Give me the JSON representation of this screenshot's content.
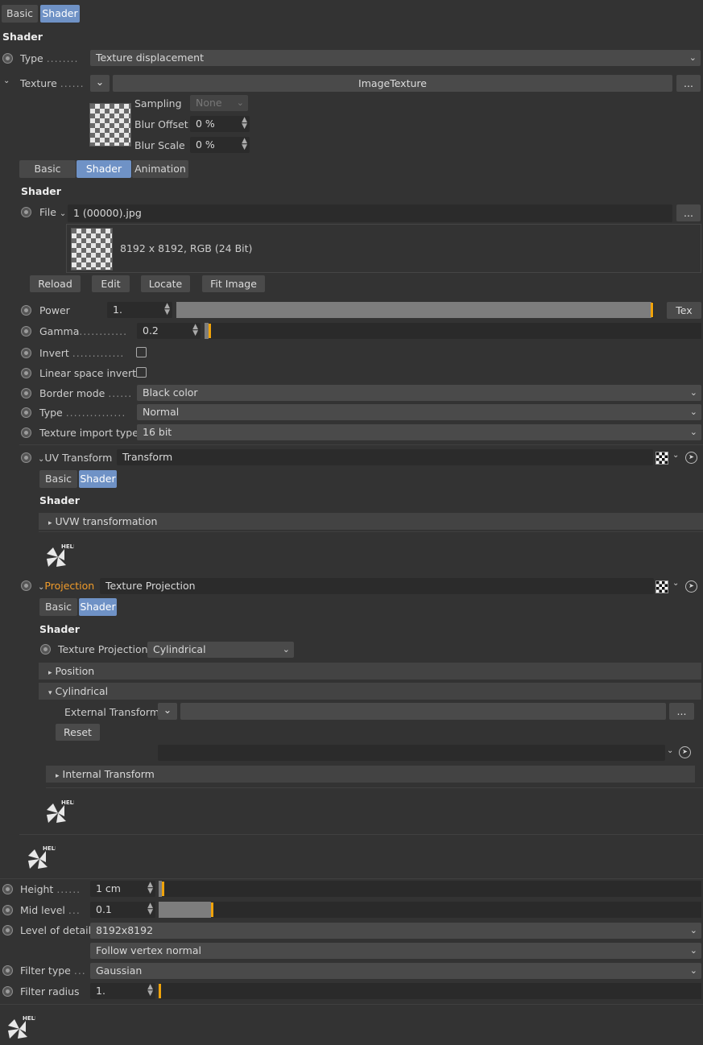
{
  "top_tabs": [
    "Basic",
    "Shader"
  ],
  "shader_header": "Shader",
  "type_row": {
    "label": "Type",
    "dots": "........",
    "value": "Texture displacement"
  },
  "texture_row": {
    "label": "Texture",
    "dots": "......",
    "name": "ImageTexture",
    "more": "..."
  },
  "sampling": {
    "label": "Sampling",
    "value": "None"
  },
  "blur_offset": {
    "label": "Blur Offset",
    "value": "0 %"
  },
  "blur_scale": {
    "label": "Blur Scale",
    "value": "0 %"
  },
  "inner_tabs": [
    "Basic",
    "Shader",
    "Animation"
  ],
  "inner_shader_header": "Shader",
  "file_row": {
    "label": "File",
    "value": "1 (00000).jpg",
    "more": "..."
  },
  "file_info": "8192 x 8192, RGB (24 Bit)",
  "file_buttons": [
    "Reload",
    "Edit",
    "Locate",
    "Fit Image"
  ],
  "power": {
    "label": "Power",
    "value": "1.",
    "button": "Tex",
    "level": 1.0
  },
  "gamma": {
    "label": "Gamma",
    "dots": "............",
    "value": "0.2",
    "level": 0.0
  },
  "invert": {
    "label": "Invert",
    "dots": ".............",
    "checked": false
  },
  "linear_invert": {
    "label": "Linear space invert",
    "checked": false
  },
  "border_mode": {
    "label": "Border mode",
    "dots": "......",
    "value": "Black color"
  },
  "type2": {
    "label": "Type",
    "dots": "...............",
    "value": "Normal"
  },
  "tex_import": {
    "label": "Texture import type",
    "value": "16 bit"
  },
  "uv_transform": {
    "label": "UV Transform",
    "value": "Transform"
  },
  "uv_tabs": [
    "Basic",
    "Shader"
  ],
  "uv_shader_header": "Shader",
  "uvw_section": "UVW transformation",
  "help_text": "HELP",
  "projection": {
    "label": "Projection",
    "value": "Texture Projection"
  },
  "proj_tabs": [
    "Basic",
    "Shader"
  ],
  "proj_shader_header": "Shader",
  "tex_projection": {
    "label": "Texture Projection",
    "value": "Cylindrical"
  },
  "position_section": "Position",
  "cylindrical_section": "Cylindrical",
  "external_transform": {
    "label": "External Transform",
    "more": "..."
  },
  "reset_button": "Reset",
  "internal_transform": "Internal Transform",
  "height": {
    "label": "Height",
    "dots": "......",
    "value": "1 cm",
    "level": 0.01
  },
  "mid_level": {
    "label": "Mid level",
    "dots": "...",
    "value": "0.1",
    "level": 0.1
  },
  "level_detail": {
    "label": "Level of detail",
    "value": "8192x8192"
  },
  "follow": {
    "value": "Follow vertex normal"
  },
  "filter_type": {
    "label": "Filter type",
    "dots": "...",
    "value": "Gaussian"
  },
  "filter_radius": {
    "label": "Filter radius",
    "value": "1."
  },
  "colors": {
    "accent": "#6f92c6",
    "knob": "#f0a30a",
    "background": "#333333",
    "projection_label": "#f09b2a"
  }
}
